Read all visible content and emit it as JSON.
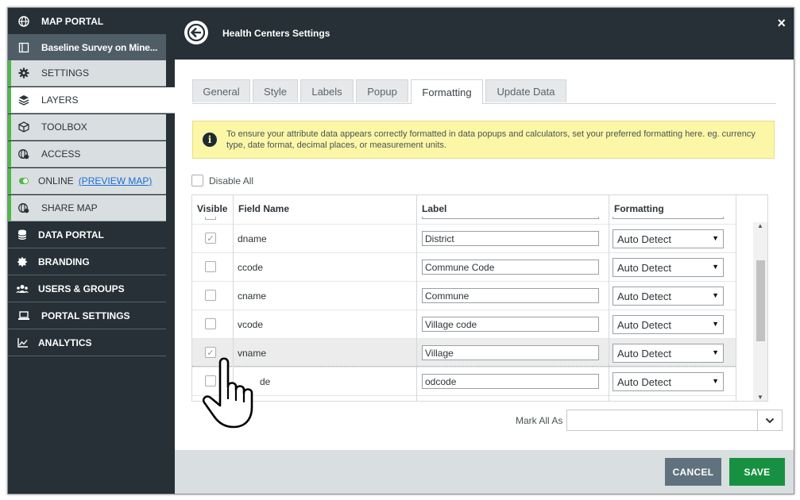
{
  "sidebar": {
    "items": [
      {
        "label": "MAP PORTAL",
        "icon": "globe-icon"
      },
      {
        "label": "Baseline Survey on Mine...",
        "icon": "book-icon"
      },
      {
        "label": "SETTINGS",
        "icon": "gear-icon"
      },
      {
        "label": "LAYERS",
        "icon": "layers-icon"
      },
      {
        "label": "TOOLBOX",
        "icon": "cube-icon"
      },
      {
        "label": "ACCESS",
        "icon": "access-globe-icon"
      },
      {
        "label": "ONLINE",
        "link": "(PREVIEW MAP)",
        "icon": "toggle-icon"
      },
      {
        "label": "SHARE MAP",
        "icon": "share-globe-icon"
      },
      {
        "label": "DATA PORTAL",
        "icon": "database-icon"
      },
      {
        "label": "BRANDING",
        "icon": "badge-icon"
      },
      {
        "label": "USERS & GROUPS",
        "icon": "users-icon"
      },
      {
        "label": "PORTAL SETTINGS",
        "icon": "laptop-icon"
      },
      {
        "label": "ANALYTICS",
        "icon": "chart-icon"
      }
    ]
  },
  "panel": {
    "title": "Health Centers Settings",
    "close": "×"
  },
  "tabs": [
    {
      "label": "General"
    },
    {
      "label": "Style"
    },
    {
      "label": "Labels"
    },
    {
      "label": "Popup"
    },
    {
      "label": "Formatting",
      "active": true
    },
    {
      "label": "Update Data"
    }
  ],
  "info": {
    "text": "To ensure your attribute data appears correctly formatted in data popups and calculators, set your preferred formatting here. eg. currency type, date format, decimal places, or measurement units."
  },
  "disable_all": {
    "label": "Disable All",
    "checked": false
  },
  "table": {
    "headers": {
      "visible": "Visible",
      "field": "Field Name",
      "label": "Label",
      "formatting": "Formatting"
    },
    "rows": [
      {
        "field": "dname",
        "label": "District",
        "format": "Auto Detect",
        "checked": true
      },
      {
        "field": "ccode",
        "label": "Commune Code",
        "format": "Auto Detect",
        "checked": false
      },
      {
        "field": "cname",
        "label": "Commune",
        "format": "Auto Detect",
        "checked": false
      },
      {
        "field": "vcode",
        "label": "Village code",
        "format": "Auto Detect",
        "checked": false
      },
      {
        "field": "vname",
        "label": "Village",
        "format": "Auto Detect",
        "checked": true
      },
      {
        "field": "de",
        "label": "odcode",
        "format": "Auto Detect",
        "checked": false
      }
    ],
    "checkmark": "✓"
  },
  "mark_all": {
    "label": "Mark All As",
    "value": ""
  },
  "footer": {
    "cancel": "CANCEL",
    "save": "SAVE"
  },
  "colors": {
    "sidebar_bg": "#263036",
    "accent_green": "#4db848",
    "save_green": "#179141",
    "cancel_gray": "#5f727e",
    "info_yellow": "#fcf7a6"
  }
}
